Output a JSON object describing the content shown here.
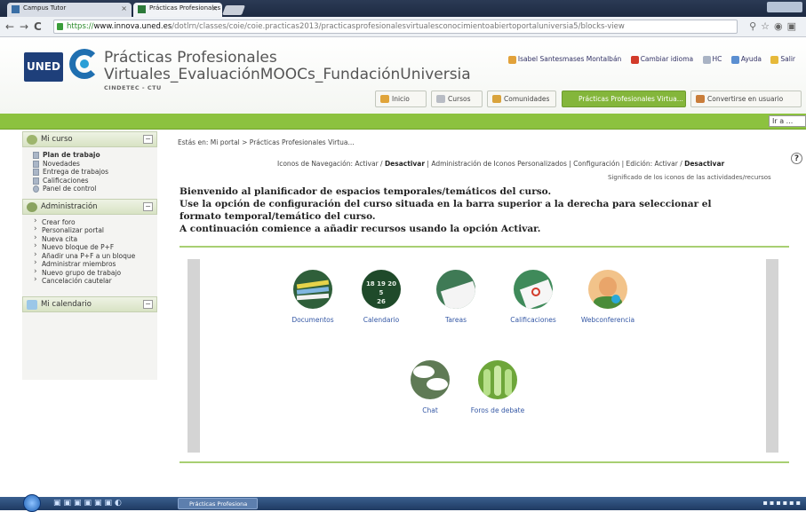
{
  "browser": {
    "tabs": [
      {
        "label": "Campus Tutor"
      },
      {
        "label": "Prácticas Profesionales Vi"
      }
    ],
    "url_https": "https://",
    "url_domain": "www.innova.uned.es",
    "url_path": "/dotlrn/classes/coie/coie.practicas2013/practicasprofesionalesvirtualesconocimientoabiertoportaluniversia5/blocks-view"
  },
  "header": {
    "logo_text": "UNED",
    "title_line1": "Prácticas Profesionales",
    "title_line2": "Virtuales_EvaluaciónMOOCs_FundaciónUniversia",
    "subtitle": "CINDETEC - CTU",
    "user_name": "Isabel Santesmases Montalbán",
    "change_language": "Cambiar idioma",
    "hc": "HC",
    "help": "Ayuda",
    "logout": "Salir",
    "nav_tabs": [
      "Inicio",
      "Cursos",
      "Comunidades",
      "Prácticas Profesionales Virtua...",
      "Convertirse en usuario"
    ],
    "goto": "Ir a ..."
  },
  "sidebar": {
    "course_block_title": "Mi curso",
    "course_items": [
      "Plan de trabajo",
      "Novedades",
      "Entrega de trabajos",
      "Calificaciones",
      "Panel de control"
    ],
    "admin_block_title": "Administración",
    "admin_items": [
      "Crear foro",
      "Personalizar portal",
      "Nueva cita",
      "Nuevo bloque de P+F",
      "Añadir una P+F a un bloque",
      "Administrar miembros",
      "Nuevo grupo de trabajo",
      "Cancelación cautelar"
    ],
    "calendar_block_title": "Mi calendario"
  },
  "main": {
    "breadcrumb": "Estás en: Mi portal > Prácticas Profesionales Virtua...",
    "icons_nav_prefix": "Iconos de Navegación: Activar / ",
    "icons_nav_bold": "Desactivar",
    "icons_nav_suffix": " | Administración de Iconos Personalizados | Configuración | Edición: Activar / ",
    "edit_bold": "Desactivar",
    "meaning_link": "Significado de los iconos de las actividades/recursos",
    "welcome_1": "Bienvenido al planificador de espacios temporales/temáticos del curso.",
    "welcome_2": "Use la opción de configuración del curso situada en la barra superior a la derecha para seleccionar el formato temporal/temático del curso.",
    "welcome_3": "A continuación comience a añadir recursos usando la opción Activar.",
    "resources": [
      {
        "label": "Documentos",
        "color": "#2f5f3a"
      },
      {
        "label": "Calendario",
        "color": "#1f4a2a"
      },
      {
        "label": "Tareas",
        "color": "#3f7a55"
      },
      {
        "label": "Calificaciones",
        "color": "#3f8a5a"
      },
      {
        "label": "Webconferencia",
        "color": "#e9b070"
      },
      {
        "label": "Chat",
        "color": "#5f7a55"
      },
      {
        "label": "Foros de debate",
        "color": "#6ea63a"
      }
    ]
  },
  "taskbar": {
    "task_label": "Prácticas Profesiona"
  }
}
